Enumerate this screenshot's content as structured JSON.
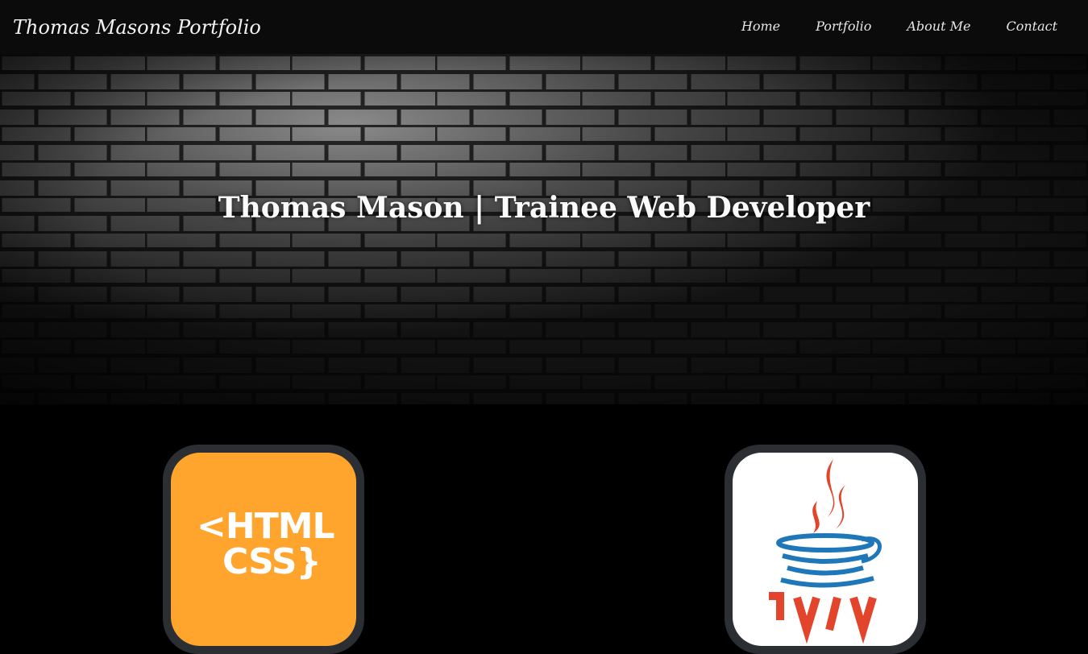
{
  "navbar": {
    "brand": "Thomas Masons Portfolio",
    "links": [
      "Home",
      "Portfolio",
      "About Me",
      "Contact"
    ]
  },
  "hero": {
    "title": "Thomas Mason | Trainee Web Developer"
  },
  "skills": {
    "html_logo_line1": "<HTML",
    "html_logo_line2": "CSS}",
    "java_logo_icon": "java-logo-icon"
  }
}
